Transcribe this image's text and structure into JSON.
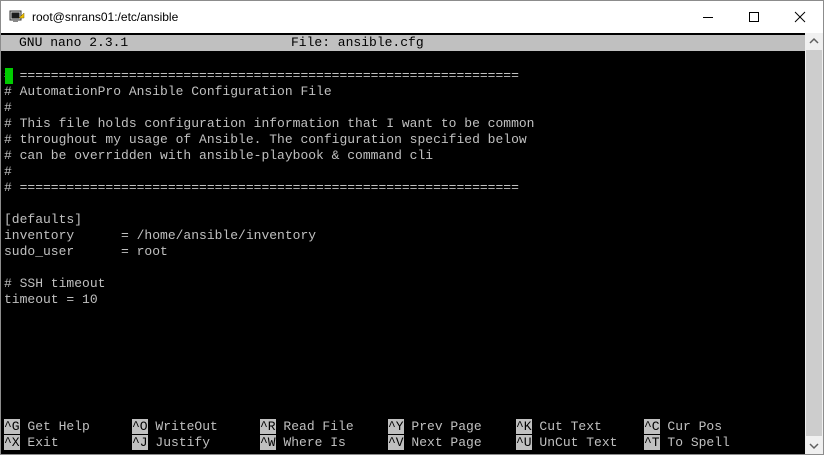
{
  "window": {
    "title": "root@snrans01:/etc/ansible"
  },
  "nano": {
    "version_label": "GNU nano 2.3.1",
    "file_label": "File: ansible.cfg"
  },
  "file_lines": [
    "# ================================================================",
    "# AutomationPro Ansible Configuration File",
    "#",
    "# This file holds configuration information that I want to be common",
    "# throughout my usage of Ansible. The configuration specified below",
    "# can be overridden with ansible-playbook & command cli",
    "#",
    "# ================================================================",
    "",
    "[defaults]",
    "inventory      = /home/ansible/inventory",
    "sudo_user      = root",
    "",
    "# SSH timeout",
    "timeout = 10"
  ],
  "shortcuts": [
    [
      {
        "key": "^G",
        "label": "Get Help"
      },
      {
        "key": "^O",
        "label": "WriteOut"
      },
      {
        "key": "^R",
        "label": "Read File"
      },
      {
        "key": "^Y",
        "label": "Prev Page"
      },
      {
        "key": "^K",
        "label": "Cut Text"
      },
      {
        "key": "^C",
        "label": "Cur Pos"
      }
    ],
    [
      {
        "key": "^X",
        "label": "Exit"
      },
      {
        "key": "^J",
        "label": "Justify"
      },
      {
        "key": "^W",
        "label": "Where Is"
      },
      {
        "key": "^V",
        "label": "Next Page"
      },
      {
        "key": "^U",
        "label": "UnCut Text"
      },
      {
        "key": "^T",
        "label": "To Spell"
      }
    ]
  ],
  "colors": {
    "terminal_bg": "#000000",
    "terminal_fg": "#c0c0c0",
    "cursor": "#00cc00"
  }
}
